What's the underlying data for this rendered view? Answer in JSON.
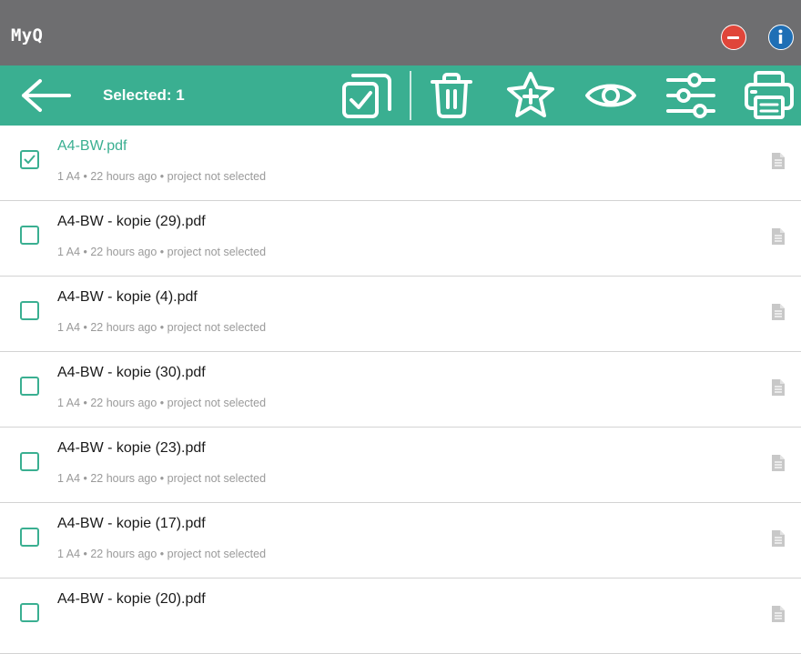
{
  "app": {
    "title": "MyQ"
  },
  "titlebar": {
    "close_icon": "minus-circle-icon",
    "info_icon": "info-icon"
  },
  "colors": {
    "accent": "#3aaf91",
    "titlebar": "#6e6e70",
    "close": "#e0463a",
    "info": "#1f6fb5"
  },
  "toolbar": {
    "selected_label": "Selected: 1",
    "icons": [
      "back-arrow-icon",
      "select-all-icon",
      "trash-icon",
      "star-add-icon",
      "eye-icon",
      "sliders-icon",
      "printer-icon"
    ]
  },
  "files": [
    {
      "name": "A4-BW.pdf",
      "meta": "1 A4 • 22 hours ago • project not selected",
      "checked": true
    },
    {
      "name": "A4-BW - kopie (29).pdf",
      "meta": "1 A4 • 22 hours ago • project not selected",
      "checked": false
    },
    {
      "name": "A4-BW - kopie (4).pdf",
      "meta": "1 A4 • 22 hours ago • project not selected",
      "checked": false
    },
    {
      "name": "A4-BW - kopie (30).pdf",
      "meta": "1 A4 • 22 hours ago • project not selected",
      "checked": false
    },
    {
      "name": "A4-BW - kopie (23).pdf",
      "meta": "1 A4 • 22 hours ago • project not selected",
      "checked": false
    },
    {
      "name": "A4-BW - kopie (17).pdf",
      "meta": "1 A4 • 22 hours ago • project not selected",
      "checked": false
    },
    {
      "name": "A4-BW - kopie (20).pdf",
      "meta": "",
      "checked": false
    }
  ]
}
